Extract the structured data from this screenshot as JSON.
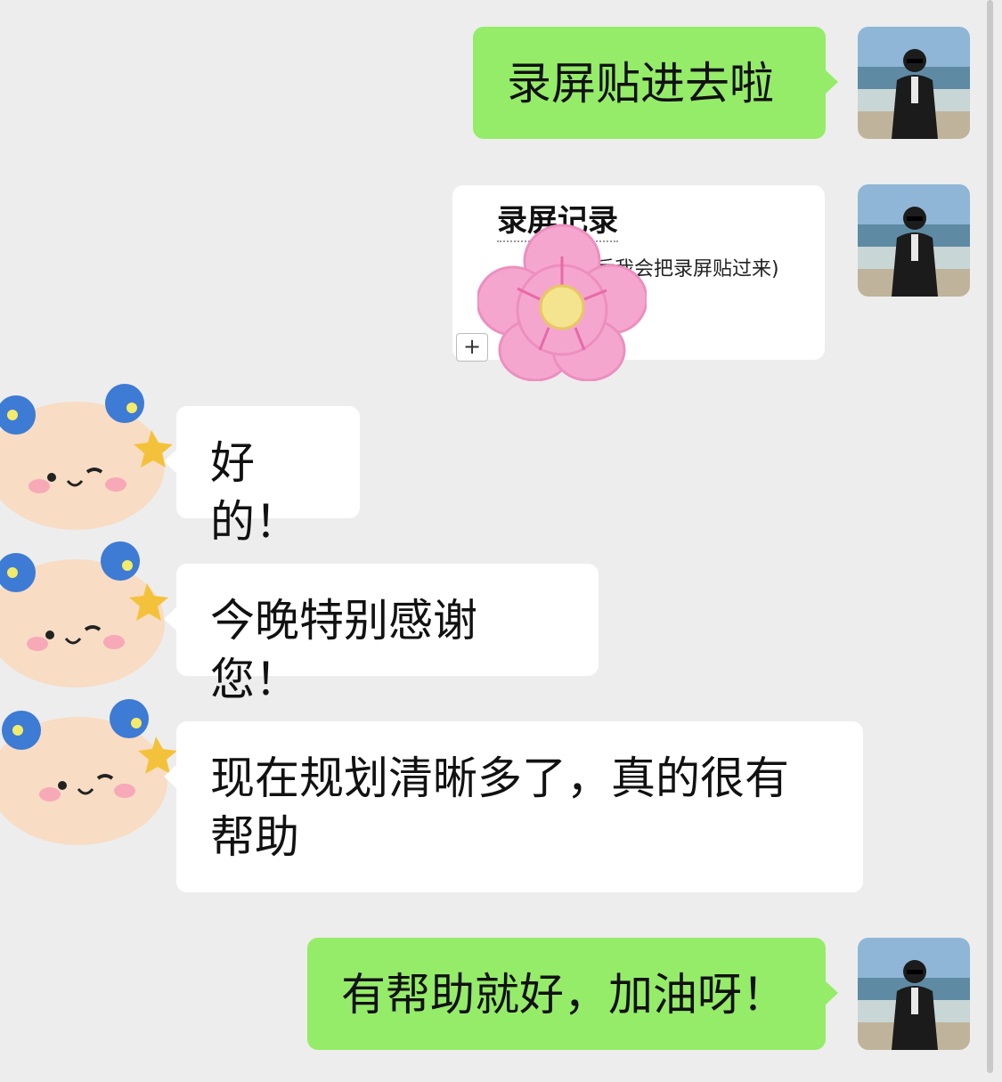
{
  "messages": [
    {
      "from": "me",
      "type": "text",
      "text": "录屏贴进去啦"
    },
    {
      "from": "me",
      "type": "doc_card",
      "title": "录屏记录",
      "subtitle": "后我会把录屏贴过来)",
      "plus": "+"
    },
    {
      "from": "other",
      "type": "text",
      "text": "好的！"
    },
    {
      "from": "other",
      "type": "text",
      "text": "今晚特别感谢您！"
    },
    {
      "from": "other",
      "type": "text",
      "text_line1": "现在规划清晰多了，真的很有",
      "text_line2": "帮助"
    },
    {
      "from": "me",
      "type": "text",
      "text": "有帮助就好，加油呀！"
    }
  ],
  "colors": {
    "background": "#ededed",
    "my_bubble": "#95ec69",
    "their_bubble": "#ffffff"
  },
  "icons": {
    "my_avatar": "beach-photo-avatar",
    "their_avatar": "fluffy-bear-sticker-avatar",
    "sticker": "pink-flower-sticker"
  }
}
